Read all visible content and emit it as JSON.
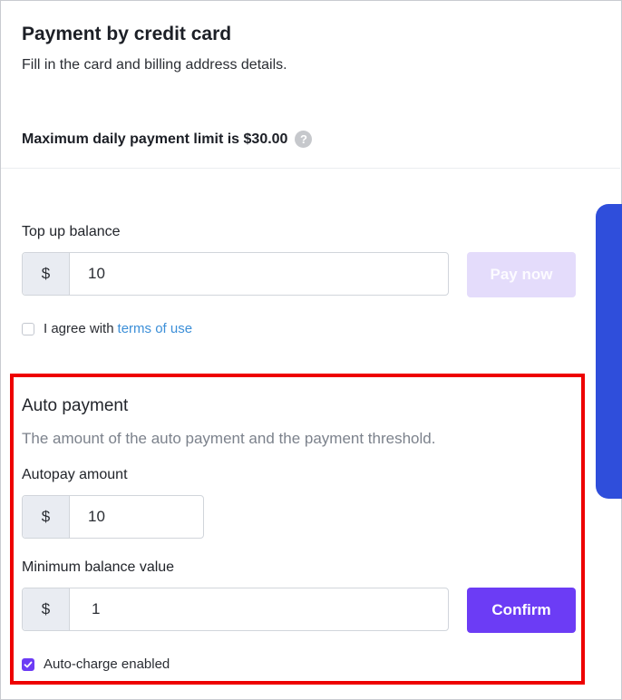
{
  "header": {
    "title": "Payment by credit card",
    "subtitle": "Fill in the card and billing address details.",
    "limit_text": "Maximum daily payment limit is $30.00",
    "help_icon": "question-circle-icon"
  },
  "topup": {
    "label": "Top up balance",
    "currency": "$",
    "amount": "10",
    "pay_button": "Pay now",
    "agree_text": "I agree with",
    "terms_link": "terms of use",
    "agree_checked": false
  },
  "auto_payment": {
    "title": "Auto payment",
    "description": "The amount of the auto payment and the payment threshold.",
    "autopay_label": "Autopay amount",
    "autopay_currency": "$",
    "autopay_amount": "10",
    "min_balance_label": "Minimum balance value",
    "min_balance_currency": "$",
    "min_balance_value": "1",
    "confirm_button": "Confirm",
    "auto_charge_label": "Auto-charge enabled",
    "auto_charge_checked": true
  },
  "colors": {
    "accent": "#6c3cf5",
    "accent_disabled": "#e4dcfb",
    "side_tab": "#2f4edb",
    "highlight": "#ee0000",
    "link": "#3c8fd8"
  }
}
